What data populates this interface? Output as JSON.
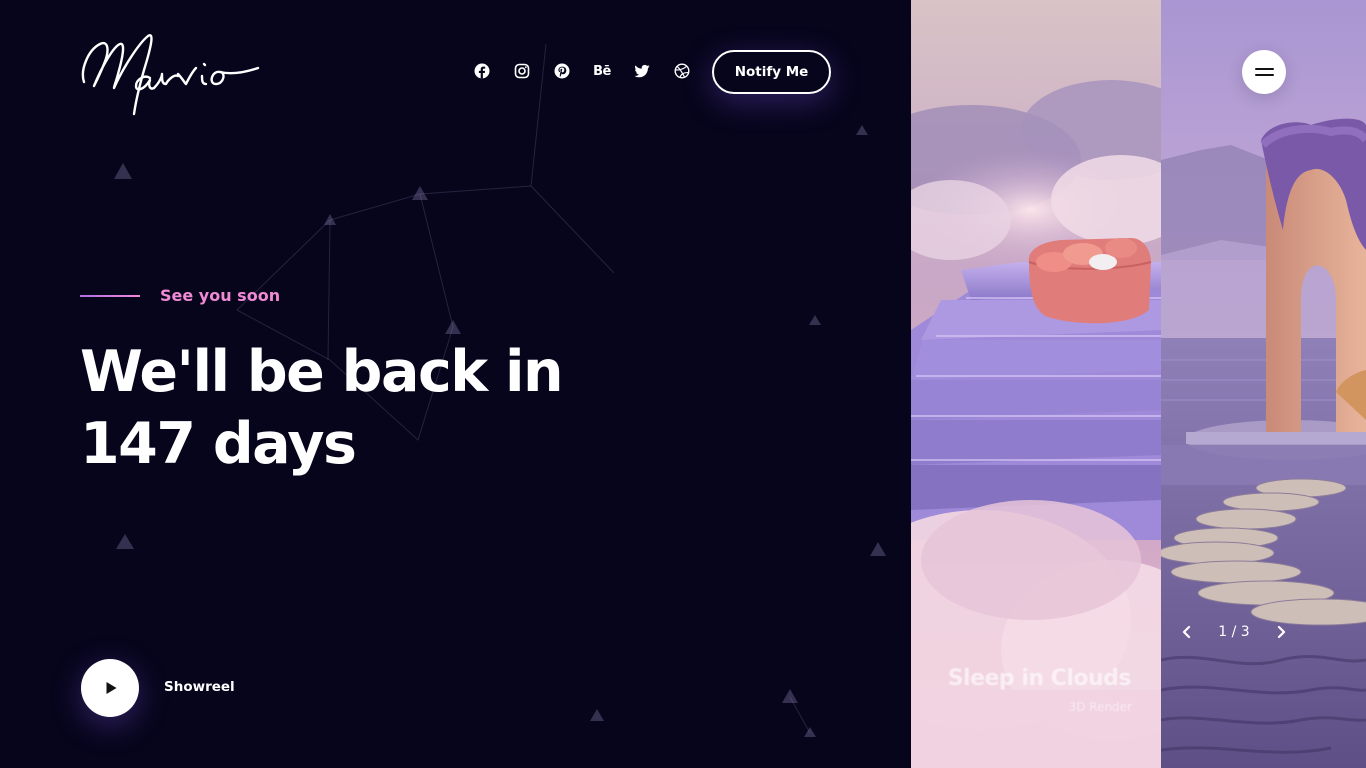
{
  "brand": {
    "logo_text": "Marvio"
  },
  "social": [
    {
      "name": "facebook",
      "icon": "facebook-icon"
    },
    {
      "name": "instagram",
      "icon": "instagram-icon"
    },
    {
      "name": "pinterest",
      "icon": "pinterest-icon"
    },
    {
      "name": "behance",
      "icon": "behance-icon",
      "label": "Bē"
    },
    {
      "name": "twitter",
      "icon": "twitter-icon"
    },
    {
      "name": "dribbble",
      "icon": "dribbble-icon"
    }
  ],
  "header": {
    "notify_label": "Notify Me"
  },
  "hero": {
    "eyebrow": "See you soon",
    "headline_line1": "We'll be back in",
    "headline_line2": "147 days"
  },
  "showreel": {
    "label": "Showreel",
    "icon": "play-icon"
  },
  "slider": {
    "slide_title": "Sleep in Clouds",
    "slide_subtitle": "3D Render",
    "pager": "1 / 3",
    "prev_icon": "chevron-left-icon",
    "next_icon": "chevron-right-icon",
    "menu_icon": "hamburger-menu-icon"
  },
  "colors": {
    "background": "#07051c",
    "accent_pink": "#f08ad4",
    "accent_purple": "#b06ee8",
    "white": "#ffffff"
  }
}
